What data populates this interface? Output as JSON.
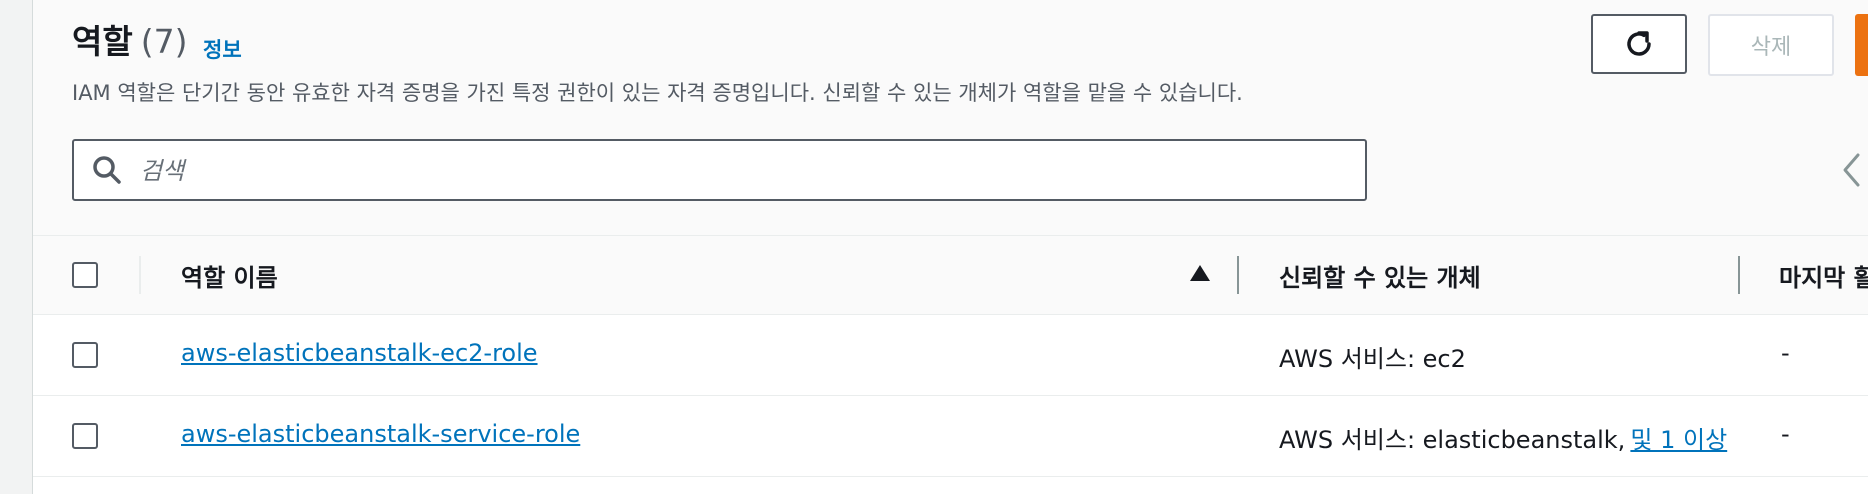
{
  "header": {
    "title": "역할",
    "count": "(7)",
    "info_link": "정보",
    "description": "IAM 역할은 단기간 동안 유효한 자격 증명을 가진 특정 권한이 있는 자격 증명입니다. 신뢰할 수 있는 개체가 역할을 맡을 수 있습니다."
  },
  "toolbar": {
    "refresh_icon": "refresh-icon",
    "delete_label": "삭제"
  },
  "search": {
    "placeholder": "검색",
    "value": ""
  },
  "table": {
    "columns": [
      "역할 이름",
      "신뢰할 수 있는 개체",
      "마지막 활"
    ],
    "sort": "ascending",
    "rows": [
      {
        "role_name": "aws-elasticbeanstalk-ec2-role",
        "trusted_entity": "AWS 서비스: ec2",
        "trusted_more": "",
        "last_activity": "-"
      },
      {
        "role_name": "aws-elasticbeanstalk-service-role",
        "trusted_entity": "AWS 서비스: elasticbeanstalk,",
        "trusted_more": "및 1 이상",
        "last_activity": "-"
      }
    ]
  },
  "colors": {
    "link": "#0073bb",
    "primary": "#ec7211",
    "text": "#16191f",
    "muted": "#545b64"
  }
}
